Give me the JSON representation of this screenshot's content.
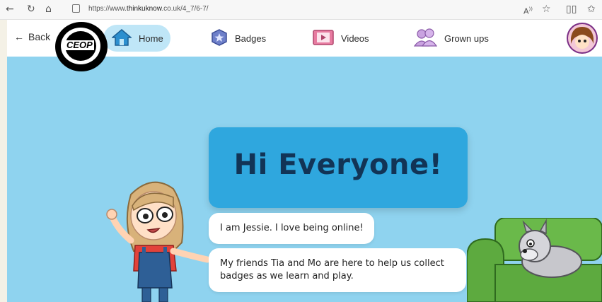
{
  "browser": {
    "url_prefix": "https://www.",
    "url_host": "thinkuknow",
    "url_suffix": ".co.uk/4_7/6-7/",
    "read_aloud_label": "A"
  },
  "nav": {
    "back_label": "Back",
    "logo_text": "CEOP",
    "items": [
      {
        "label": "Home",
        "icon": "house-icon"
      },
      {
        "label": "Badges",
        "icon": "star-badge-icon"
      },
      {
        "label": "Videos",
        "icon": "play-icon"
      },
      {
        "label": "Grown ups",
        "icon": "people-icon"
      }
    ]
  },
  "main": {
    "heading": "Hi Everyone!",
    "bubble_1": "I am Jessie. I love being online!",
    "bubble_2": "My friends Tia and Mo are here to help us collect badges as we learn and play."
  },
  "colors": {
    "background": "#8fd3ef",
    "title_card": "#2fa7de",
    "heading_text": "#123456",
    "home_pill": "#bfe6f7",
    "sofa": "#5daa3f"
  }
}
